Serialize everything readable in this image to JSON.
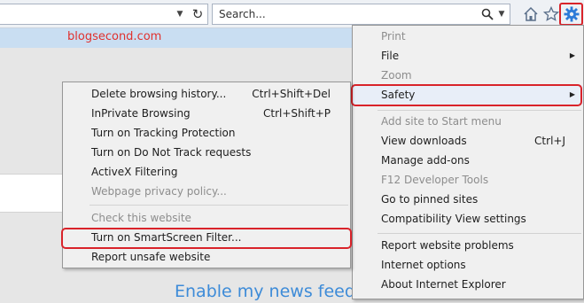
{
  "toolbar": {
    "search_placeholder": "Search...",
    "icons": [
      "address-dropdown-icon",
      "refresh-icon",
      "search-icon",
      "search-dropdown-icon",
      "home-icon",
      "favorites-star-icon",
      "tools-gear-icon"
    ]
  },
  "page": {
    "watermark": "blogsecond.com",
    "news_feed_link": "Enable my news feed"
  },
  "tools_menu": {
    "items": [
      {
        "label": "Print",
        "enabled": false
      },
      {
        "label": "File",
        "enabled": true,
        "submenu": true
      },
      {
        "label": "Zoom",
        "enabled": false
      },
      {
        "label": "Safety",
        "enabled": true,
        "submenu": true,
        "selected": true
      },
      {
        "label": "Add site to Start menu",
        "enabled": false
      },
      {
        "label": "View downloads",
        "shortcut": "Ctrl+J",
        "enabled": true
      },
      {
        "label": "Manage add-ons",
        "enabled": true
      },
      {
        "label": "F12 Developer Tools",
        "enabled": false
      },
      {
        "label": "Go to pinned sites",
        "enabled": true
      },
      {
        "label": "Compatibility View settings",
        "enabled": true
      },
      {
        "label": "Report website problems",
        "enabled": true
      },
      {
        "label": "Internet options",
        "enabled": true
      },
      {
        "label": "About Internet Explorer",
        "enabled": true
      }
    ]
  },
  "safety_menu": {
    "items": [
      {
        "label": "Delete browsing history...",
        "shortcut": "Ctrl+Shift+Del",
        "enabled": true
      },
      {
        "label": "InPrivate Browsing",
        "shortcut": "Ctrl+Shift+P",
        "enabled": true
      },
      {
        "label": "Turn on Tracking Protection",
        "enabled": true
      },
      {
        "label": "Turn on Do Not Track requests",
        "enabled": true
      },
      {
        "label": "ActiveX Filtering",
        "enabled": true
      },
      {
        "label": "Webpage privacy policy...",
        "enabled": false
      },
      {
        "label": "Check this website",
        "enabled": false
      },
      {
        "label": "Turn on SmartScreen Filter...",
        "enabled": true,
        "highlighted": true
      },
      {
        "label": "Report unsafe website",
        "enabled": true
      }
    ]
  },
  "colors": {
    "highlight_border": "#d9232a",
    "gear_icon": "#2d7bd8",
    "news_feed_link": "#3d8bd8",
    "watermark": "#e0312e"
  }
}
